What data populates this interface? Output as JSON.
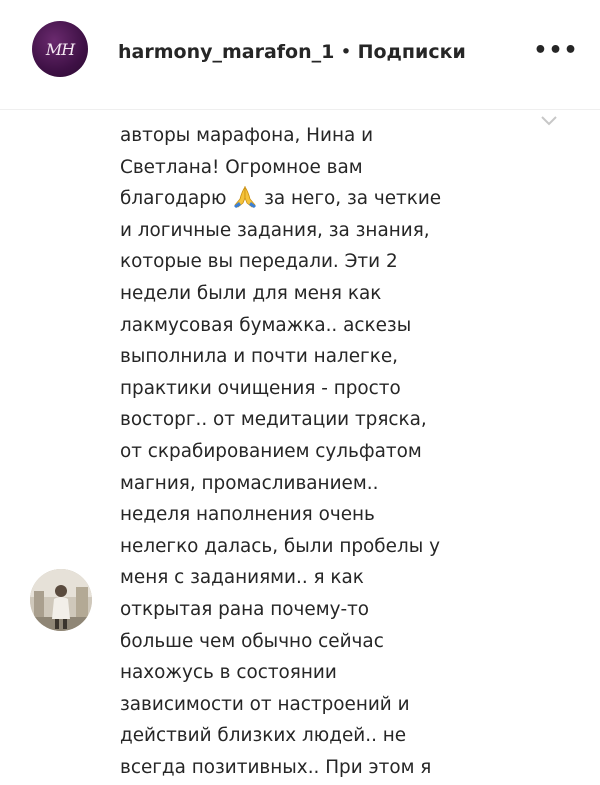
{
  "header": {
    "avatar_monogram": "MH",
    "username": "harmony_marafon_1",
    "separator": "•",
    "follow_label": "Подписки",
    "more_label": "•••"
  },
  "comment": {
    "lines_before_icon": [
      "авторы марафона, Нина и",
      "Светлана! Огромное вам"
    ],
    "line_with_icon_before": "благодарю ",
    "line_with_icon_after": " за него, за четкие",
    "icon": "folded-hands-icon",
    "lines_after_icon": [
      "и логичные задания, за знания,",
      "которые вы передали. Эти 2",
      "недели были для меня как",
      "лакмусовая бумажка.. аскезы",
      "выполнила и почти налегке,",
      "практики очищения - просто",
      "восторг.. от медитации тряска,",
      "от скрабированием сульфатом",
      "магния, промасливанием..",
      "неделя наполнения очень",
      "нелегко далась, были пробелы у",
      "меня с заданиями.. я как",
      "открытая рана почему-то",
      "больше чем обычно сейчас",
      "нахожусь в состоянии",
      "зависимости от настроений и",
      "действий близких людей.. не",
      "всегда позитивных.. При этом я"
    ]
  },
  "colors": {
    "text": "#262626",
    "divider": "#efefef",
    "brand_avatar": "#3f1146",
    "chevron": "#c7c7c7"
  }
}
